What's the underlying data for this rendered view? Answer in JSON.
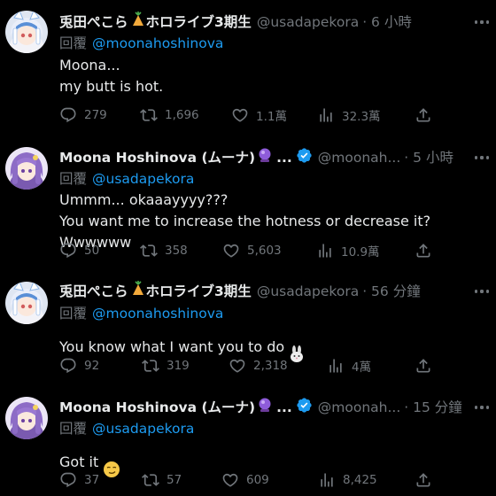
{
  "tweets": [
    {
      "name": "兎田ぺこら",
      "name_suffix": "ホロライブ3期生",
      "handle": "@usadapekora",
      "time": "· 6 小時",
      "verified": false,
      "reply_label": "回覆",
      "reply_to": "@moonahoshinova",
      "text": "Moona...\nmy butt is hot.",
      "replies": "279",
      "reposts": "1,696",
      "likes": "1.1萬",
      "views": "32.3萬"
    },
    {
      "name": "Moona Hoshinova (ムーナ)",
      "name_suffix": "...",
      "handle": "@moonah...",
      "time": "· 5 小時",
      "verified": true,
      "reply_label": "回覆",
      "reply_to": "@usadapekora",
      "text": "Ummm... okaaayyyy???\nYou want me to increase the hotness or decrease it? Wwwwww",
      "replies": "50",
      "reposts": "358",
      "likes": "5,603",
      "views": "10.9萬"
    },
    {
      "name": "兎田ぺこら",
      "name_suffix": "ホロライブ3期生",
      "handle": "@usadapekora",
      "time": "· 56 分鐘",
      "verified": false,
      "reply_label": "回覆",
      "reply_to": "@moonahoshinova",
      "text": "You know what I want you to do",
      "replies": "92",
      "reposts": "319",
      "likes": "2,318",
      "views": "4萬"
    },
    {
      "name": "Moona Hoshinova (ムーナ)",
      "name_suffix": "...",
      "handle": "@moonah...",
      "time": "· 15 分鐘",
      "verified": true,
      "reply_label": "回覆",
      "reply_to": "@usadapekora",
      "text": "Got it",
      "replies": "37",
      "reposts": "57",
      "likes": "609",
      "views": "8,425"
    }
  ],
  "colors": {
    "background": "#000000",
    "text": "#e7e9ea",
    "muted": "#71767b",
    "link": "#1d9bf0",
    "verified": "#1d9bf0"
  },
  "icons": {
    "reply": "speech-bubble-icon",
    "repost": "repost-arrows-icon",
    "like": "heart-icon",
    "views": "bar-chart-icon",
    "share": "share-upload-icon",
    "more": "more-dots-icon",
    "verified": "verified-badge-icon"
  }
}
